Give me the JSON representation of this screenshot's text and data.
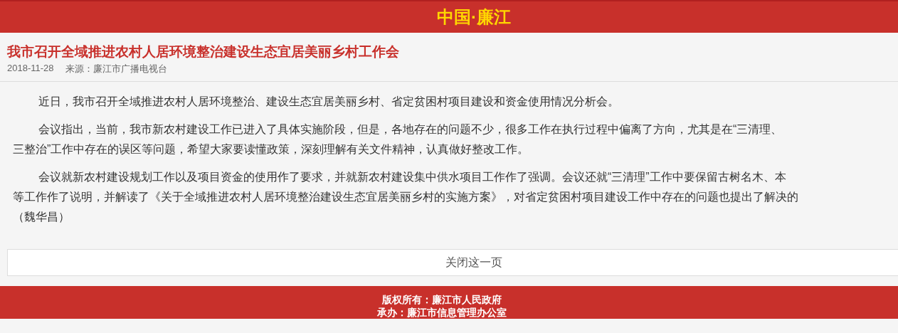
{
  "header": {
    "logo": "中国·廉江"
  },
  "article": {
    "title": "我市召开全域推进农村人居环境整治建设生态宜居美丽乡村工作会",
    "date": "2018-11-28",
    "source": "来源：廉江市广播电视台",
    "paragraphs": [
      {
        "lines": [
          "近日，我市召开全域推进农村人居环境整治、建设生态宜居美丽乡村、省定贫困村项目建设和资金使用情况分析会。"
        ]
      },
      {
        "lines": [
          "会议指出，当前，我市新农村建设工作已进入了具体实施阶段，但是，各地存在的问题不少，很多工作在执行过程中偏离了方向，尤其是在“三清理、",
          "三整治”工作中存在的误区等问题，希望大家要读懂政策，深刻理解有关文件精神，认真做好整改工作。"
        ]
      },
      {
        "lines": [
          "会议就新农村建设规划工作以及项目资金的使用作了要求，并就新农村建设集中供水项目工作作了强调。会议还就“三清理”工作中要保留古树名木、本",
          "等工作作了说明，并解读了《关于全域推进农村人居环境整治建设生态宜居美丽乡村的实施方案》，对省定贫困村项目建设工作中存在的问题也提出了解决的",
          "（魏华昌）"
        ]
      }
    ]
  },
  "close_button": "关闭这一页",
  "footer": {
    "lines": [
      "版权所有：廉江市人民政府",
      "承办：廉江市信息管理办公室"
    ]
  }
}
